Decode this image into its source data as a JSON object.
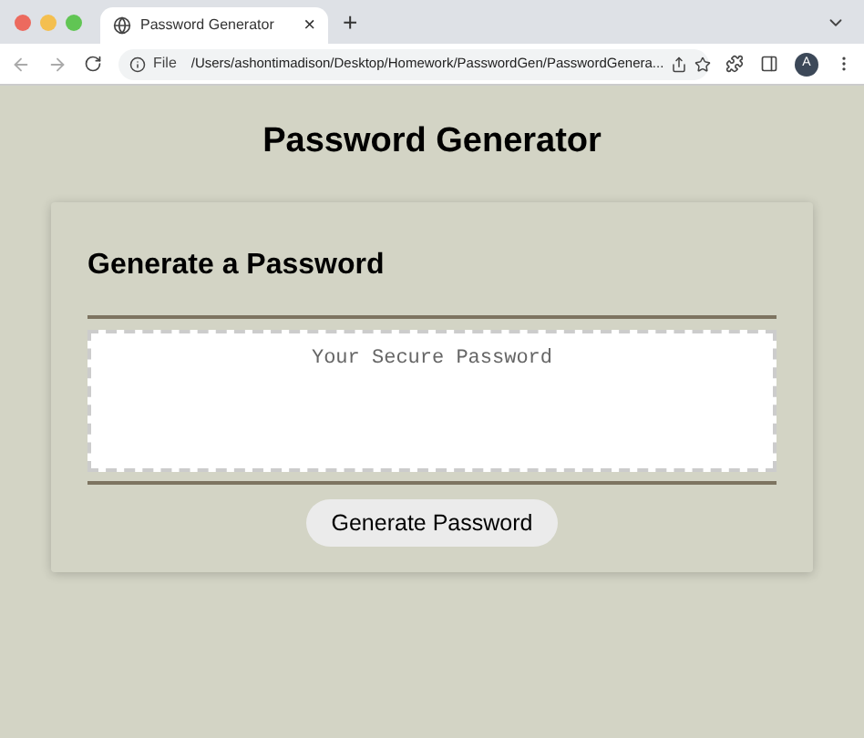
{
  "browser": {
    "tab": {
      "title": "Password Generator",
      "close": "×"
    },
    "new_tab": "+",
    "address": {
      "scheme": "File",
      "url": "/Users/ashontimadison/Desktop/Homework/PasswordGen/PasswordGenera..."
    },
    "profile": "A"
  },
  "page": {
    "title": "Password Generator",
    "card": {
      "heading": "Generate a Password",
      "password": {
        "placeholder": "Your Secure Password"
      },
      "button": "Generate Password"
    }
  }
}
